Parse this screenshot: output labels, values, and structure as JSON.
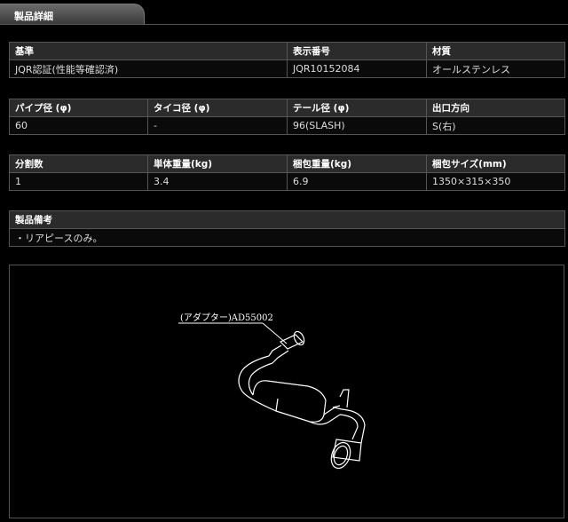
{
  "section": {
    "title": "製品詳細"
  },
  "table1": {
    "headers": [
      "基準",
      "表示番号",
      "材質"
    ],
    "values": [
      "JQR認証(性能等確認済)",
      "JQR10152084",
      "オールステンレス"
    ]
  },
  "table2": {
    "headers": [
      "パイプ径 (φ)",
      "タイコ径 (φ)",
      "テール径 (φ)",
      "出口方向"
    ],
    "values": [
      "60",
      "-",
      "96(SLASH)",
      "S(右)"
    ]
  },
  "table3": {
    "headers": [
      "分割数",
      "単体重量(kg)",
      "梱包重量(kg)",
      "梱包サイズ(mm)"
    ],
    "values": [
      "1",
      "3.4",
      "6.9",
      "1350×315×350"
    ]
  },
  "table4": {
    "header": "製品備考",
    "note": "・リアピースのみ。"
  },
  "diagram": {
    "label": "(アダプター)AD55002"
  },
  "colors": {
    "background": "#000000",
    "header_bg": "#2b2b2b",
    "border": "#555555"
  }
}
